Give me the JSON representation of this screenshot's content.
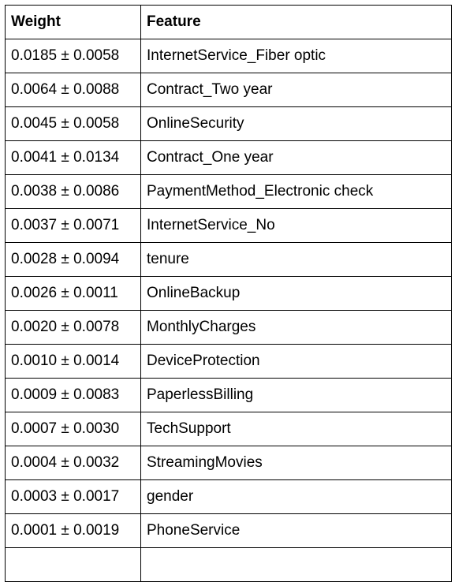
{
  "table": {
    "headers": [
      "Weight",
      "Feature"
    ],
    "rows": [
      [
        "0.0185 ± 0.0058",
        "InternetService_Fiber optic"
      ],
      [
        "0.0064 ± 0.0088",
        "Contract_Two year"
      ],
      [
        "0.0045 ± 0.0058",
        "OnlineSecurity"
      ],
      [
        "0.0041 ± 0.0134",
        "Contract_One year"
      ],
      [
        "0.0038 ± 0.0086",
        "PaymentMethod_Electronic check"
      ],
      [
        "0.0037 ± 0.0071",
        "InternetService_No"
      ],
      [
        "0.0028 ± 0.0094",
        "tenure"
      ],
      [
        "0.0026 ± 0.0011",
        "OnlineBackup"
      ],
      [
        "0.0020 ± 0.0078",
        "MonthlyCharges"
      ],
      [
        "0.0010 ± 0.0014",
        "DeviceProtection"
      ],
      [
        "0.0009 ± 0.0083",
        "PaperlessBilling"
      ],
      [
        "0.0007 ± 0.0030",
        "TechSupport"
      ],
      [
        "0.0004 ± 0.0032",
        "StreamingMovies"
      ],
      [
        "0.0003 ± 0.0017",
        "gender"
      ],
      [
        "0.0001 ± 0.0019",
        "PhoneService"
      ],
      [
        "",
        ""
      ]
    ]
  }
}
